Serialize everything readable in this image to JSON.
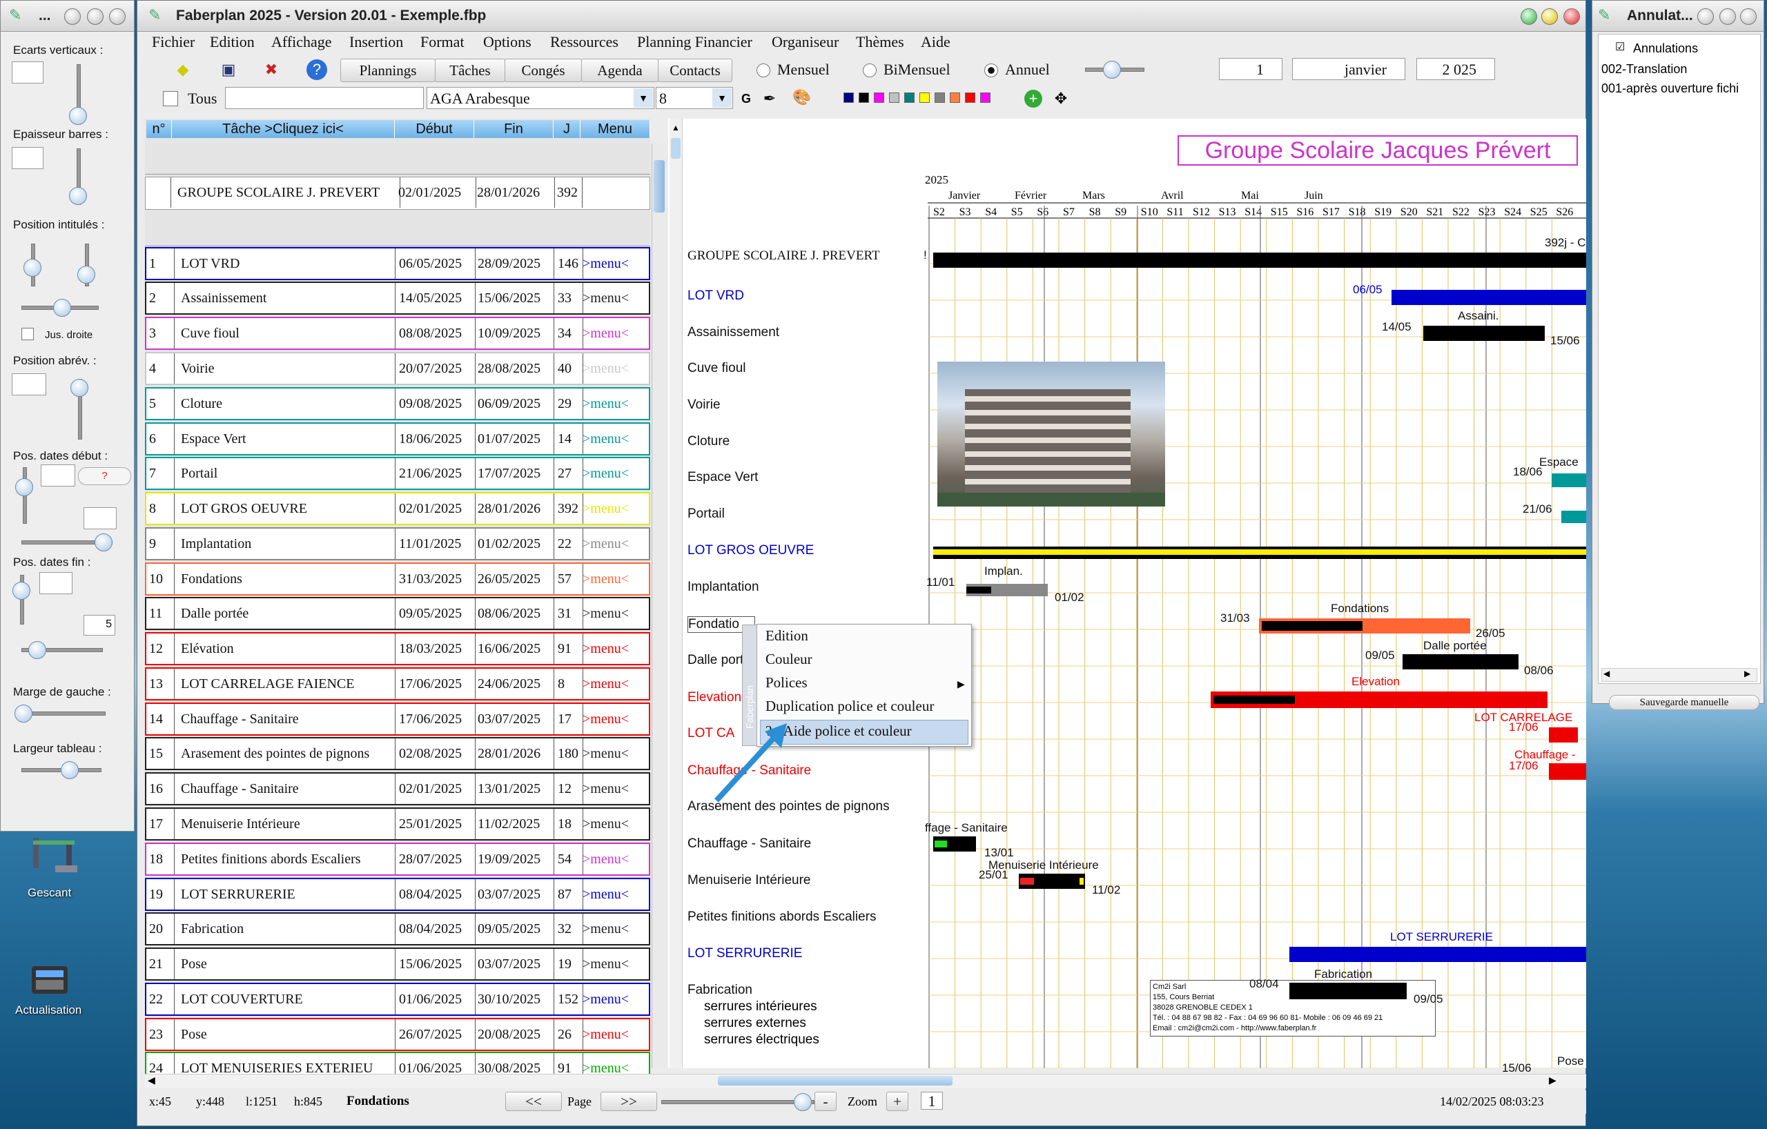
{
  "desktop": {
    "icons": [
      {
        "label": "Gescant"
      },
      {
        "label": "Actualisation"
      }
    ]
  },
  "left_panel": {
    "title": "...",
    "items": [
      {
        "label": "Ecarts verticaux :"
      },
      {
        "label": "Epaisseur barres :"
      },
      {
        "label": "Position intitulés :"
      },
      {
        "label": "Jus. droite"
      },
      {
        "label": "Position abrév. :"
      },
      {
        "label": "Pos. dates début :"
      },
      {
        "label": "Pos. dates fin :"
      },
      {
        "label": "Marge de gauche :"
      },
      {
        "label": "Largeur tableau :"
      }
    ],
    "qmark": "?",
    "fin_value": "5"
  },
  "app": {
    "title": "Faberplan 2025 - Version 20.01 - Exemple.fbp",
    "menu": [
      "Fichier",
      "Edition",
      "Affichage",
      "Insertion",
      "Format",
      "Options",
      "Ressources",
      "Planning Financier",
      "Organiseur",
      "Thèmes",
      "Aide"
    ],
    "toolbar_buttons": [
      "Plannings",
      "Tâches",
      "Congés",
      "Agenda",
      "Contacts"
    ],
    "view_modes": [
      "Mensuel",
      "BiMensuel",
      "Annuel"
    ],
    "selected_view": "Annuel",
    "day": "1",
    "month": "janvier",
    "year": "2 025",
    "tous": "Tous",
    "font": "AGA Arabesque",
    "font_size": "8",
    "bold": "G",
    "palette": [
      "#000080",
      "#000000",
      "#ff00ff",
      "#c0c0c0",
      "#008080",
      "#ffff00",
      "#808080",
      "#ff8040",
      "#ff0000",
      "#ff00ff"
    ]
  },
  "table": {
    "headers": [
      "n°",
      "Tâche  >Cliquez ici<",
      "Début",
      "Fin",
      "J",
      "Menu"
    ],
    "group": {
      "name": "GROUPE SCOLAIRE J. PREVERT",
      "start": "02/01/2025",
      "end": "28/01/2026",
      "days": "392"
    },
    "rows": [
      {
        "n": "1",
        "name": "LOT VRD",
        "start": "06/05/2025",
        "end": "28/09/2025",
        "days": "146",
        "menu": ">menu<",
        "color": "#0000cc"
      },
      {
        "n": "2",
        "name": "Assainissement",
        "start": "14/05/2025",
        "end": "15/06/2025",
        "days": "33",
        "menu": ">menu<",
        "color": "#222222"
      },
      {
        "n": "3",
        "name": "Cuve fioul",
        "start": "08/08/2025",
        "end": "10/09/2025",
        "days": "34",
        "menu": ">menu<",
        "color": "#cc33cc"
      },
      {
        "n": "4",
        "name": "Voirie",
        "start": "20/07/2025",
        "end": "28/08/2025",
        "days": "40",
        "menu": ">menu<",
        "color": "#c8c8c8"
      },
      {
        "n": "5",
        "name": "Cloture",
        "start": "09/08/2025",
        "end": "06/09/2025",
        "days": "29",
        "menu": ">menu<",
        "color": "#009999"
      },
      {
        "n": "6",
        "name": "Espace Vert",
        "start": "18/06/2025",
        "end": "01/07/2025",
        "days": "14",
        "menu": ">menu<",
        "color": "#009999"
      },
      {
        "n": "7",
        "name": "Portail",
        "start": "21/06/2025",
        "end": "17/07/2025",
        "days": "27",
        "menu": ">menu<",
        "color": "#009999"
      },
      {
        "n": "8",
        "name": "LOT GROS OEUVRE",
        "start": "02/01/2025",
        "end": "28/01/2026",
        "days": "392",
        "menu": ">menu<",
        "color": "#e6e600"
      },
      {
        "n": "9",
        "name": "Implantation",
        "start": "11/01/2025",
        "end": "01/02/2025",
        "days": "22",
        "menu": ">menu<",
        "color": "#888888"
      },
      {
        "n": "10",
        "name": "Fondations",
        "start": "31/03/2025",
        "end": "26/05/2025",
        "days": "57",
        "menu": ">menu<",
        "color": "#ff6633"
      },
      {
        "n": "11",
        "name": "Dalle portée",
        "start": "09/05/2025",
        "end": "08/06/2025",
        "days": "31",
        "menu": ">menu<",
        "color": "#222222"
      },
      {
        "n": "12",
        "name": "Elévation",
        "start": "18/03/2025",
        "end": "16/06/2025",
        "days": "91",
        "menu": ">menu<",
        "color": "#ee0000"
      },
      {
        "n": "13",
        "name": "LOT CARRELAGE FAIENCE",
        "start": "17/06/2025",
        "end": "24/06/2025",
        "days": "8",
        "menu": ">menu<",
        "color": "#ee0000"
      },
      {
        "n": "14",
        "name": "Chauffage - Sanitaire",
        "start": "17/06/2025",
        "end": "03/07/2025",
        "days": "17",
        "menu": ">menu<",
        "color": "#ee0000"
      },
      {
        "n": "15",
        "name": "Arasement des pointes  de pignons",
        "start": "02/08/2025",
        "end": "28/01/2026",
        "days": "180",
        "menu": ">menu<",
        "color": "#222222"
      },
      {
        "n": "16",
        "name": "Chauffage - Sanitaire",
        "start": "02/01/2025",
        "end": "13/01/2025",
        "days": "12",
        "menu": ">menu<",
        "color": "#222222"
      },
      {
        "n": "17",
        "name": "Menuiserie Intérieure",
        "start": "25/01/2025",
        "end": "11/02/2025",
        "days": "18",
        "menu": ">menu<",
        "color": "#222222"
      },
      {
        "n": "18",
        "name": "Petites finitions abords Escaliers",
        "start": "28/07/2025",
        "end": "19/09/2025",
        "days": "54",
        "menu": ">menu<",
        "color": "#cc33cc"
      },
      {
        "n": "19",
        "name": "LOT SERRURERIE",
        "start": "08/04/2025",
        "end": "03/07/2025",
        "days": "87",
        "menu": ">menu<",
        "color": "#0000cc"
      },
      {
        "n": "20",
        "name": "Fabrication",
        "start": "08/04/2025",
        "end": "09/05/2025",
        "days": "32",
        "menu": ">menu<",
        "color": "#222222"
      },
      {
        "n": "21",
        "name": "Pose",
        "start": "15/06/2025",
        "end": "03/07/2025",
        "days": "19",
        "menu": ">menu<",
        "color": "#222222"
      },
      {
        "n": "22",
        "name": "LOT COUVERTURE",
        "start": "01/06/2025",
        "end": "30/10/2025",
        "days": "152",
        "menu": ">menu<",
        "color": "#0000cc"
      },
      {
        "n": "23",
        "name": "Pose",
        "start": "26/07/2025",
        "end": "20/08/2025",
        "days": "26",
        "menu": ">menu<",
        "color": "#ee0000"
      },
      {
        "n": "24",
        "name": "LOT MENUISERIES EXTERIEU",
        "start": "01/06/2025",
        "end": "30/08/2025",
        "days": "91",
        "menu": ">menu<",
        "color": "#00aa00"
      }
    ]
  },
  "gantt": {
    "title": "Groupe Scolaire Jacques Prévert",
    "year": "2025",
    "months": [
      "Janvier",
      "Février",
      "Mars",
      "Avril",
      "Mai",
      "Juin"
    ],
    "weeks": [
      "S2",
      "S3",
      "S4",
      "S5",
      "S6",
      "S7",
      "S8",
      "S9",
      "S10",
      "S11",
      "S12",
      "S13",
      "S14",
      "S15",
      "S16",
      "S17",
      "S18",
      "S19",
      "S20",
      "S21",
      "S22",
      "S23",
      "S24",
      "S25",
      "S26"
    ],
    "labels": [
      "GROUPE SCOLAIRE J. PREVERT",
      "LOT VRD",
      "Assainissement",
      "Cuve fioul",
      "Voirie",
      "Cloture",
      "Espace Vert",
      "Portail",
      "LOT GROS OEUVRE",
      "Implantation",
      "Fondations",
      "Dalle portée",
      "Elevation",
      "LOT CA",
      "Chauffage - Sanitaire",
      "Arasement des pointes  de pignons",
      "Chauffage - Sanitaire",
      "Menuiserie Intérieure",
      "Petites finitions abords Escaliers",
      "LOT SERRURERIE",
      "Fabrication"
    ],
    "sublabels": [
      "serrures intérieures",
      "serrures externes",
      "serrures électriques"
    ],
    "annotations": {
      "group_days": "392j - C",
      "vrd": "06/05",
      "assain_start": "14/05",
      "assain_name": "Assaini.",
      "assain_end": "15/06",
      "espace": "Espace",
      "espace_start": "18/06",
      "portail_start": "21/06",
      "impl_name": "Implan.",
      "impl_start": "11/01",
      "impl_end": "01/02",
      "fond_name": "Fondations",
      "fond_start": "31/03",
      "fond_end": "26/05",
      "dalle_start": "09/05",
      "dalle_name": "Dalle portée",
      "dalle_end": "08/06",
      "elev_name": "Elevation",
      "carrelage": "LOT CARRELAGE",
      "carr_start": "17/06",
      "chauffage": "Chauffage -",
      "chauf_start": "17/06",
      "chauf2_name": "ffage - Sanitaire",
      "chauf2_end": "13/01",
      "menu_start": "25/01",
      "menu_name": "Menuiserie Intérieure",
      "menu_end": "11/02",
      "serr_name": "LOT SERRURERIE",
      "fab_start": "08/04",
      "fab_name": "Fabrication",
      "fab_end": "09/05",
      "pose_start": "15/06",
      "pose_name": "Pose",
      "fond_box": "Fondatio",
      "edge_mark": "!"
    },
    "company": [
      "Cm2i Sarl",
      "155, Cours Berriat",
      "38028 GRENOBLE CEDEX 1",
      "Tél. : 04 88 67 98 82 - Fax : 04 69 96 60 81- Mobile : 06 09 46 69 21",
      "Email : cm2i@cm2i.com - http://www.faberplan.fr"
    ]
  },
  "context_menu": {
    "side": "Faberplan",
    "items": [
      "Edition",
      "Couleur",
      "Polices",
      "Duplication police et couleur",
      "? - Aide police et couleur"
    ]
  },
  "status": {
    "x": "x:45",
    "y": "y:448",
    "l": "l:1251",
    "h": "h:845",
    "task": "Fondations",
    "prev": "<<",
    "page": "Page",
    "next": ">>",
    "minus": "-",
    "zoom": "Zoom",
    "plus": "+",
    "zoom_value": "1",
    "datetime": "14/02/2025 08:03:23"
  },
  "right_panel": {
    "title": "Annulat...",
    "header": "Annulations",
    "items": [
      "002-Translation",
      "001-après ouverture fichi"
    ],
    "save": "Sauvegarde manuelle"
  }
}
